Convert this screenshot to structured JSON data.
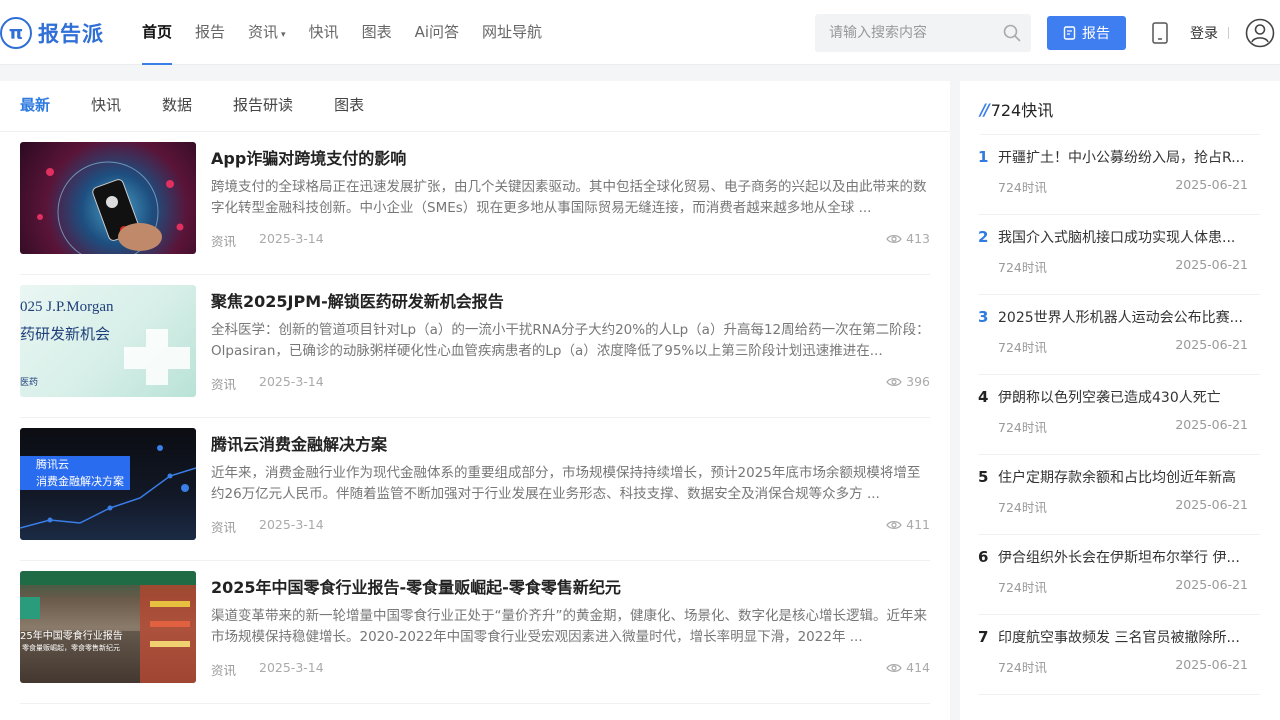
{
  "header": {
    "logo_text": "报告派",
    "logo_mark": "π",
    "nav": [
      {
        "label": "首页",
        "active": true
      },
      {
        "label": "报告"
      },
      {
        "label": "资讯",
        "dropdown": true
      },
      {
        "label": "快讯"
      },
      {
        "label": "图表"
      },
      {
        "label": "Ai问答"
      },
      {
        "label": "网址导航"
      }
    ],
    "search_placeholder": "请输入搜索内容",
    "report_button": "报告",
    "login": "登录"
  },
  "main": {
    "tabs": [
      "最新",
      "快讯",
      "数据",
      "报告研读",
      "图表"
    ],
    "articles": [
      {
        "title": "App诈骗对跨境支付的影响",
        "summary": "跨境支付的全球格局正在迅速发展扩张，由几个关键因素驱动。其中包括全球化贸易、电子商务的兴起以及由此带来的数字化转型金融科技创新。中小企业（SMEs）现在更多地从事国际贸易无缝连接，而消费者越来越多地从全球 ...",
        "category": "资讯",
        "date": "2025-3-14",
        "views": "413"
      },
      {
        "title": "聚焦2025JPM-解锁医药研发新机会报告",
        "summary": "全科医学：创新的管道项目针对Lp（a）的一流小干扰RNA分子大约20%的人Lp（a）升高每12周给药一次在第二阶段：Olpasiran，已确诊的动脉粥样硬化性心血管疾病患者的Lp（a）浓度降低了95%以上第三阶段计划迅速推进在...",
        "category": "资讯",
        "date": "2025-3-14",
        "views": "396",
        "thumb_text_1": "025 J.P.Morgan",
        "thumb_text_2": "药研发新机会",
        "thumb_text_3": "医药"
      },
      {
        "title": "腾讯云消费金融解决方案",
        "summary": "近年来，消费金融行业作为现代金融体系的重要组成部分，市场规模保持持续增长，预计2025年底市场余额规模将增至约26万亿元人民币。伴随着监管不断加强对于行业发展在业务形态、科技支撑、数据安全及消保合规等众多方 ...",
        "category": "资讯",
        "date": "2025-3-14",
        "views": "411",
        "thumb_text_1": "腾讯云",
        "thumb_text_2": "消费金融解决方案"
      },
      {
        "title": "2025年中国零食行业报告-零食量贩崛起-零食零售新纪元",
        "summary": "渠道变革带来的新一轮增量中国零食行业正处于“量价齐升”的黄金期，健康化、场景化、数字化是核心增长逻辑。近年来市场规模保持稳健增长。2020-2022年中国零食行业受宏观因素进入微量时代，增长率明显下滑，2022年 ...",
        "category": "资讯",
        "date": "2025-3-14",
        "views": "414",
        "thumb_text_1": "25年中国零食行业报告",
        "thumb_text_2": "零食量贩崛起，零食零售新纪元"
      }
    ]
  },
  "side": {
    "title": "724快讯",
    "items": [
      {
        "num": "1",
        "title": "开疆扩土！中小公募纷纷入局，抢占R...",
        "source": "724时讯",
        "date": "2025-06-21"
      },
      {
        "num": "2",
        "title": "我国介入式脑机接口成功实现人体患...",
        "source": "724时讯",
        "date": "2025-06-21"
      },
      {
        "num": "3",
        "title": "2025世界人形机器人运动会公布比赛...",
        "source": "724时讯",
        "date": "2025-06-21"
      },
      {
        "num": "4",
        "title": "伊朗称以色列空袭已造成430人死亡",
        "source": "724时讯",
        "date": "2025-06-21"
      },
      {
        "num": "5",
        "title": "住户定期存款余额和占比均创近年新高",
        "source": "724时讯",
        "date": "2025-06-21"
      },
      {
        "num": "6",
        "title": "伊合组织外长会在伊斯坦布尔举行 伊...",
        "source": "724时讯",
        "date": "2025-06-21"
      },
      {
        "num": "7",
        "title": "印度航空事故频发 三名官员被撤除所...",
        "source": "724时讯",
        "date": "2025-06-21"
      }
    ]
  },
  "colors": {
    "accent": "#2f7be0",
    "button": "#3f7ef0"
  }
}
